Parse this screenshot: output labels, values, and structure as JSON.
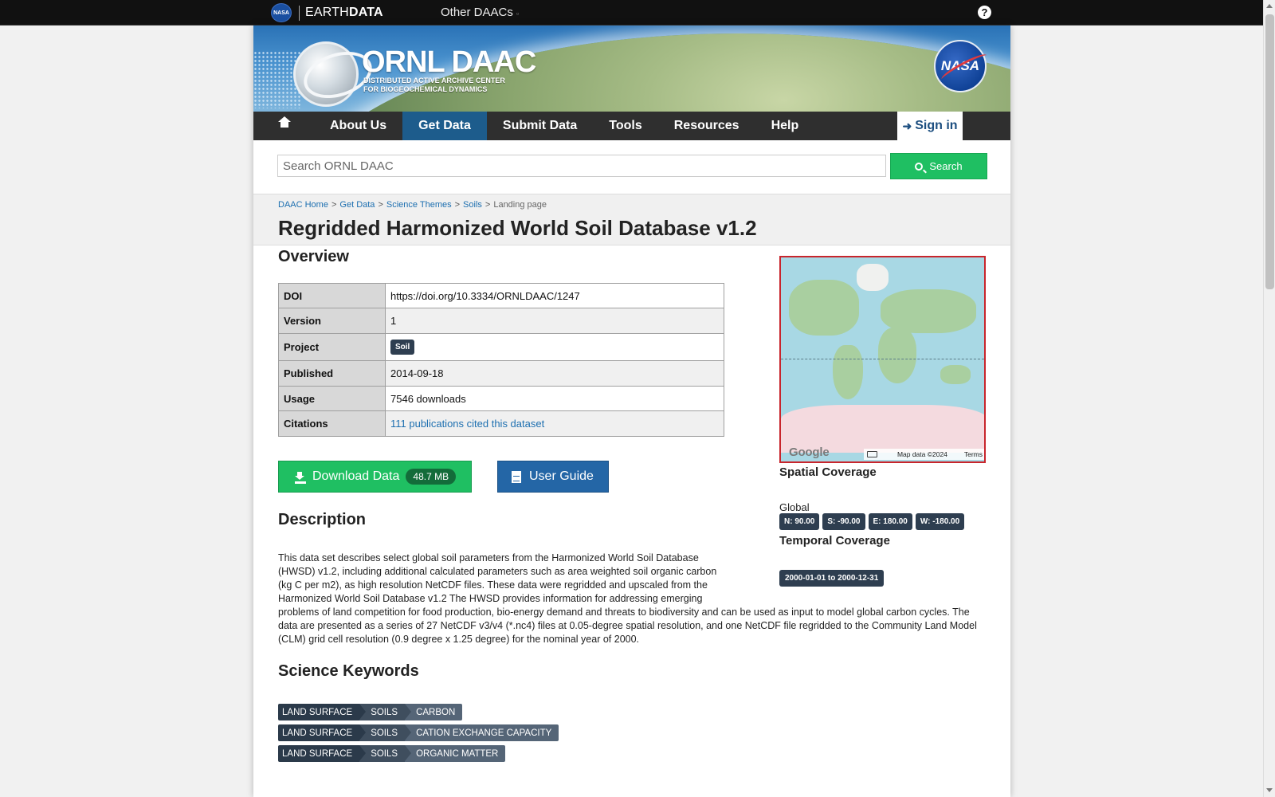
{
  "earthdata": {
    "nasa_logo_text": "NASA",
    "brand_light": "EARTH",
    "brand_bold": "DATA",
    "other_daacs": "Other DAACs",
    "help": "?"
  },
  "banner": {
    "title": "ORNL DAAC",
    "subtitle_line1": "DISTRIBUTED ACTIVE ARCHIVE CENTER",
    "subtitle_line2": "FOR BIOGEOCHEMICAL DYNAMICS",
    "nasa_text": "NASA"
  },
  "nav": {
    "home_icon": "home-icon",
    "items": [
      "About Us",
      "Get Data",
      "Submit Data",
      "Tools",
      "Resources",
      "Help"
    ],
    "active": "Get Data",
    "signin": "Sign in",
    "signin_icon": "sign-in-icon"
  },
  "search": {
    "placeholder": "Search ORNL DAAC",
    "button": "Search",
    "icon": "search-icon"
  },
  "breadcrumb": {
    "items": [
      "DAAC Home",
      "Get Data",
      "Science Themes",
      "Soils"
    ],
    "current": "Landing page",
    "separator": ">"
  },
  "page_title": "Regridded Harmonized World Soil Database v1.2",
  "overview": {
    "heading": "Overview",
    "rows": [
      {
        "key": "DOI",
        "value": "https://doi.org/10.3334/ORNLDAAC/1247"
      },
      {
        "key": "Version",
        "value": "1"
      },
      {
        "key": "Project",
        "value": "Soil"
      },
      {
        "key": "Published",
        "value": "2014-09-18"
      },
      {
        "key": "Usage",
        "value": "7546 downloads"
      },
      {
        "key": "Citations",
        "value": "111 publications cited this dataset"
      }
    ]
  },
  "buttons": {
    "download": "Download Data",
    "download_size": "48.7 MB",
    "download_icon": "download-icon",
    "user_guide": "User Guide",
    "user_guide_icon": "document-icon"
  },
  "description": {
    "heading": "Description",
    "text": "This data set describes select global soil parameters from the Harmonized World Soil Database (HWSD) v1.2, including additional calculated parameters such as area weighted soil organic carbon (kg C per m2), as high resolution NetCDF files. These data were regridded and upscaled from the Harmonized World Soil Database v1.2 The HWSD provides information for addressing emerging problems of land competition for food production, bio-energy demand and threats to biodiversity and can be used as input to model global carbon cycles. The data are presented as a series of 27 NetCDF v3/v4 (*.nc4) files at 0.05-degree spatial resolution, and one NetCDF file regridded to the Community Land Model (CLM) grid cell resolution (0.9 degree x 1.25 degree) for the nominal year of 2000."
  },
  "keywords": {
    "heading": "Science Keywords",
    "rows": [
      [
        "LAND SURFACE",
        "SOILS",
        "CARBON"
      ],
      [
        "LAND SURFACE",
        "SOILS",
        "CATION EXCHANGE CAPACITY"
      ],
      [
        "LAND SURFACE",
        "SOILS",
        "ORGANIC MATTER"
      ]
    ]
  },
  "map": {
    "google": "Google",
    "attribution": "Map data ©2024",
    "terms": "Terms",
    "keyboard_icon": "keyboard-icon"
  },
  "spatial": {
    "heading": "Spatial Coverage",
    "label": "Global",
    "north": "N: 90.00",
    "south": "S: -90.00",
    "east": "E: 180.00",
    "west": "W: -180.00"
  },
  "temporal": {
    "heading": "Temporal Coverage",
    "range": "2000-01-01 to 2000-12-31"
  },
  "colors": {
    "accent_green": "#1fbf62",
    "accent_blue": "#2466a6",
    "badge_dark": "#2e3e50",
    "nav_active": "#1d5c8c"
  }
}
